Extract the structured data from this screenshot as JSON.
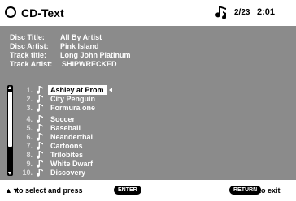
{
  "header": {
    "title": "CD-Text",
    "track_count": "2/23",
    "time": "2:01",
    "icons": {
      "disc": "disc-icon",
      "music": "music-note-icon"
    }
  },
  "info": {
    "disc_title_label": "Disc Title:",
    "disc_title": "All By Artist",
    "disc_artist_label": "Disc Artist:",
    "disc_artist": "Pink Island",
    "track_title_label": "Track title:",
    "track_title": "Long John Platinum",
    "track_artist_label": "Track Artist:",
    "track_artist": "SHIPWRECKED"
  },
  "tracks": [
    {
      "num": "1.",
      "name": "Ashley at Prom",
      "selected": true
    },
    {
      "num": "2.",
      "name": "City Penguin"
    },
    {
      "num": "3.",
      "name": "Formura one"
    },
    {
      "num": "4.",
      "name": "Soccer"
    },
    {
      "num": "5.",
      "name": "Baseball"
    },
    {
      "num": "6.",
      "name": "Neanderthal"
    },
    {
      "num": "7.",
      "name": "Cartoons"
    },
    {
      "num": "8.",
      "name": "Trilobites"
    },
    {
      "num": "9.",
      "name": "White Dwarf"
    },
    {
      "num": "10.",
      "name": "Discovery"
    }
  ],
  "footer": {
    "arrows": "▲▼",
    "select_text": "to select and press",
    "enter_label": "ENTER",
    "return_label": "RETURN",
    "exit_text": "to exit"
  },
  "colors": {
    "panel": "#8b8b8b",
    "background": "#ffffff",
    "text_dark": "#000000"
  }
}
